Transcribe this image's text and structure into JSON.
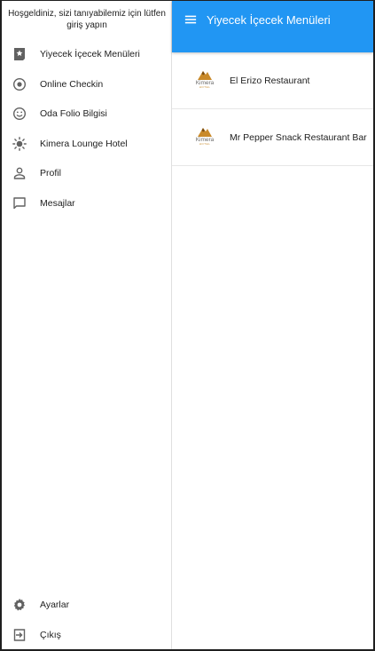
{
  "drawer": {
    "header_text": "Hoşgeldiniz, sizi tanıyabilemiz için lütfen giriş yapın",
    "items": [
      {
        "label": "Yiyecek İçecek Menüleri",
        "icon": "menu-book-icon"
      },
      {
        "label": "Online Checkin",
        "icon": "radio-target-icon"
      },
      {
        "label": "Oda Folio Bilgisi",
        "icon": "smiley-icon"
      },
      {
        "label": "Kimera Lounge Hotel",
        "icon": "sun-icon"
      },
      {
        "label": "Profil",
        "icon": "person-icon"
      },
      {
        "label": "Mesajlar",
        "icon": "message-icon"
      }
    ],
    "bottom_items": [
      {
        "label": "Ayarlar",
        "icon": "gear-icon"
      },
      {
        "label": "Çıkış",
        "icon": "logout-icon"
      }
    ]
  },
  "appbar": {
    "title": "Yiyecek İçecek Menüleri",
    "color": "#2196f3"
  },
  "restaurants": [
    {
      "name": "El Erizo Restaurant",
      "logo_text": "Kimera",
      "logo_sub": "HOTEL"
    },
    {
      "name": "Mr Pepper Snack Restaurant Bar",
      "logo_text": "Kimera",
      "logo_sub": "HOTEL"
    }
  ]
}
